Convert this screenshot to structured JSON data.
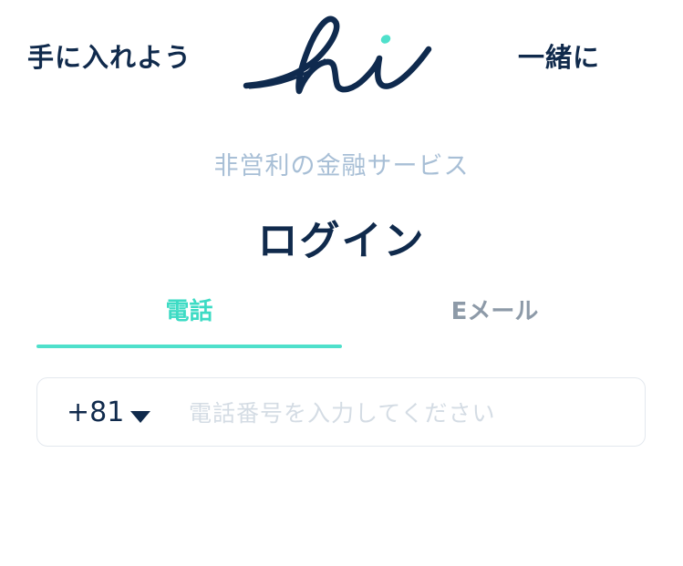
{
  "header": {
    "left_text": "手に入れよう",
    "right_text": "一緒に",
    "logo_text": "hi"
  },
  "subtitle": "非営利の金融サービス",
  "title": "ログイン",
  "tabs": [
    {
      "label": "電話",
      "active": true
    },
    {
      "label": "Eメール",
      "active": false
    }
  ],
  "phone": {
    "country_code": "+81",
    "placeholder": "電話番号を入力してください",
    "value": ""
  },
  "colors": {
    "primary": "#102a4c",
    "accent": "#3ddbc4",
    "muted": "#a8bfd6",
    "inactive_tab": "#8d9aa8",
    "border": "#e3e8ee"
  }
}
